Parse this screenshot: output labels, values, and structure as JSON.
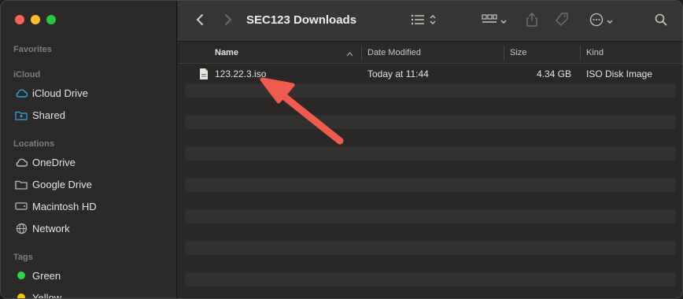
{
  "window": {
    "title": "SEC123 Downloads"
  },
  "sidebar": {
    "sections": {
      "favorites": "Favorites",
      "icloud": "iCloud",
      "locations": "Locations",
      "tags": "Tags"
    },
    "icloud_items": [
      {
        "label": "iCloud Drive",
        "icon": "cloud-icon"
      },
      {
        "label": "Shared",
        "icon": "shared-folder-icon"
      }
    ],
    "location_items": [
      {
        "label": "OneDrive",
        "icon": "cloud-icon"
      },
      {
        "label": "Google Drive",
        "icon": "folder-icon"
      },
      {
        "label": "Macintosh HD",
        "icon": "disk-icon"
      },
      {
        "label": "Network",
        "icon": "network-icon"
      }
    ],
    "tag_items": [
      {
        "label": "Green",
        "color": "#2bd24b"
      },
      {
        "label": "Yellow",
        "color": "#f5c400"
      }
    ]
  },
  "columns": {
    "name": "Name",
    "date": "Date Modified",
    "size": "Size",
    "kind": "Kind"
  },
  "files": [
    {
      "name": "123.22.3.iso",
      "date": "Today at 11:44",
      "size": "4.34 GB",
      "kind": "ISO Disk Image"
    }
  ],
  "colors": {
    "accent": "#2aa6e0",
    "annotation_arrow": "#ef5b4d"
  }
}
